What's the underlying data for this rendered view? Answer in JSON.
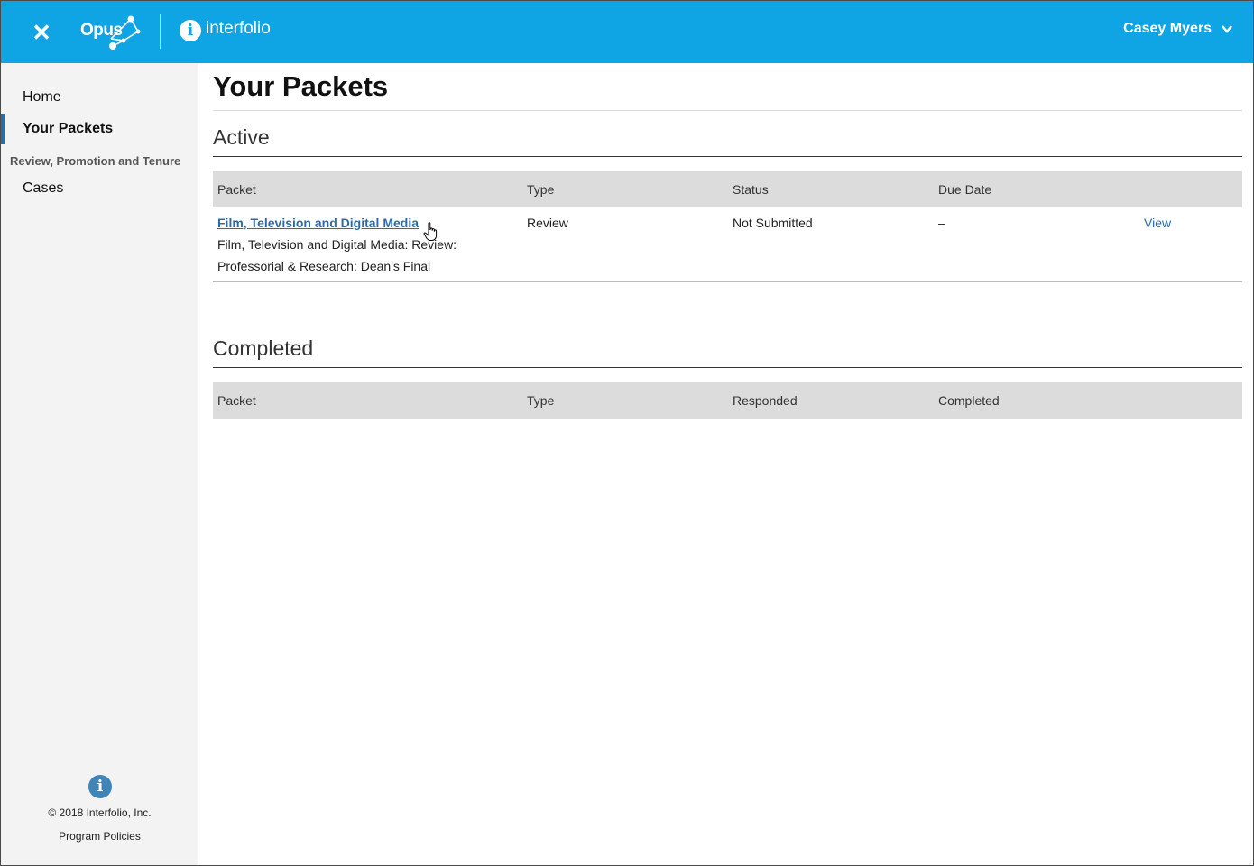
{
  "header": {
    "close_icon": "close-icon",
    "opus_label": "Opus",
    "interfolio_label": "interfolio",
    "interfolio_icon": "info-i-icon",
    "user_name": "Casey Myers",
    "accent": "#0fa4e3"
  },
  "sidebar": {
    "items": [
      {
        "label": "Home"
      },
      {
        "label": "Your Packets",
        "active": true
      }
    ],
    "section_label": "Review, Promotion and Tenure",
    "section_items": [
      {
        "label": "Cases"
      }
    ],
    "footer": {
      "copyright": "© 2018 Interfolio, Inc.",
      "policies": "Program Policies"
    }
  },
  "main": {
    "title": "Your Packets",
    "active": {
      "title": "Active",
      "columns": [
        "Packet",
        "Type",
        "Status",
        "Due Date"
      ],
      "rows": [
        {
          "packet_link": "Film, Television and Digital Media",
          "description_line1": "Film, Television and Digital Media: Review:",
          "description_line2": "Professorial & Research: Dean's Final",
          "type": "Review",
          "status": "Not Submitted",
          "due_date": "–",
          "action": "View"
        }
      ]
    },
    "completed": {
      "title": "Completed",
      "columns": [
        "Packet",
        "Type",
        "Responded",
        "Completed"
      ]
    }
  }
}
